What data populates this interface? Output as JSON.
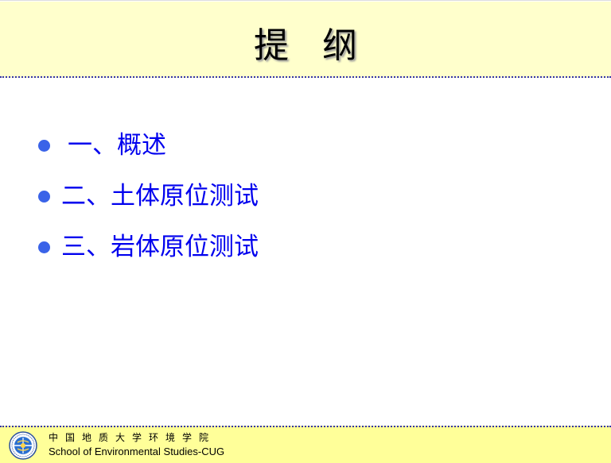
{
  "slide": {
    "title": "提 纲",
    "bullets": [
      {
        "text": "一、概述"
      },
      {
        "text": "二、土体原位测试"
      },
      {
        "text": "三、岩体原位测试"
      }
    ]
  },
  "footer": {
    "school_name_cn": "中国地质大学环境学院",
    "school_name_en": "School of Environmental Studies-CUG",
    "logo_icon": "university-seal-icon"
  },
  "colors": {
    "header_bg": "#ffffcc",
    "footer_bg": "#ffff99",
    "bullet_text": "#0000ee",
    "bullet_dot": "#3a63e8",
    "divider": "#3333aa"
  }
}
